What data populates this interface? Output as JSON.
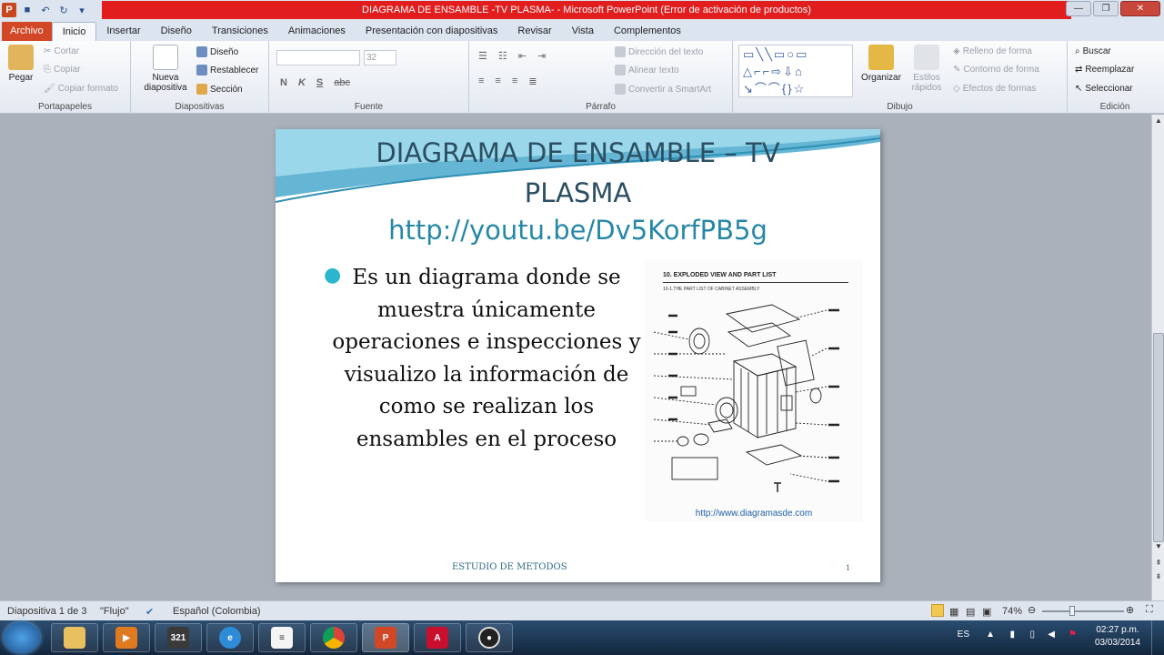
{
  "window": {
    "title": "DIAGRAMA DE ENSAMBLE -TV PLASMA- - Microsoft PowerPoint (Error de activación de productos)",
    "app_icon": "P"
  },
  "tabs": [
    "Archivo",
    "Inicio",
    "Insertar",
    "Diseño",
    "Transiciones",
    "Animaciones",
    "Presentación con diapositivas",
    "Revisar",
    "Vista",
    "Complementos"
  ],
  "ribbon": {
    "portapapeles": {
      "label": "Portapapeles",
      "pegar": "Pegar",
      "cortar": "Cortar",
      "copiar": "Copiar",
      "copiar_formato": "Copiar formato"
    },
    "diapositivas": {
      "label": "Diapositivas",
      "nueva_1": "Nueva",
      "nueva_2": "diapositiva",
      "diseno": "Diseño",
      "restablecer": "Restablecer",
      "seccion": "Sección"
    },
    "fuente": {
      "label": "Fuente",
      "size": "32",
      "bold": "N",
      "italic": "K",
      "underline": "S",
      "strike": "abc"
    },
    "parrafo": {
      "label": "Párrafo",
      "direccion": "Dirección del texto",
      "alinear": "Alinear texto",
      "convertir": "Convertir a SmartArt"
    },
    "dibujo": {
      "label": "Dibujo",
      "organizar": "Organizar",
      "estilos_1": "Estilos",
      "estilos_2": "rápidos",
      "relleno": "Relleno de forma",
      "contorno": "Contorno de forma",
      "efectos": "Efectos de formas"
    },
    "edicion": {
      "label": "Edición",
      "buscar": "Buscar",
      "reemplazar": "Reemplazar",
      "seleccionar": "Seleccionar"
    }
  },
  "slide": {
    "title_line1": "DIAGRAMA DE ENSAMBLE – TV",
    "title_line2": "PLASMA",
    "link": "http://youtu.be/Dv5KorfPB5g",
    "bullet": "Es un diagrama  donde se muestra únicamente operaciones e inspecciones y visualizo la información de como se realizan los ensambles en el proceso",
    "image_title": "10. EXPLODED VIEW AND PART LIST",
    "image_subtitle": "10-1.THE PART LIST OF CABINET ASSEMBLY",
    "image_url": "http://www.diagramasde.com",
    "footer": "ESTUDIO DE METODOS",
    "number": "1"
  },
  "status": {
    "slide_of": "Diapositiva 1 de 3",
    "theme": "\"Flujo\"",
    "language": "Español (Colombia)",
    "zoom": "74%"
  },
  "taskbar": {
    "lang": "ES",
    "time": "02:27 p.m.",
    "date": "03/03/2014"
  }
}
